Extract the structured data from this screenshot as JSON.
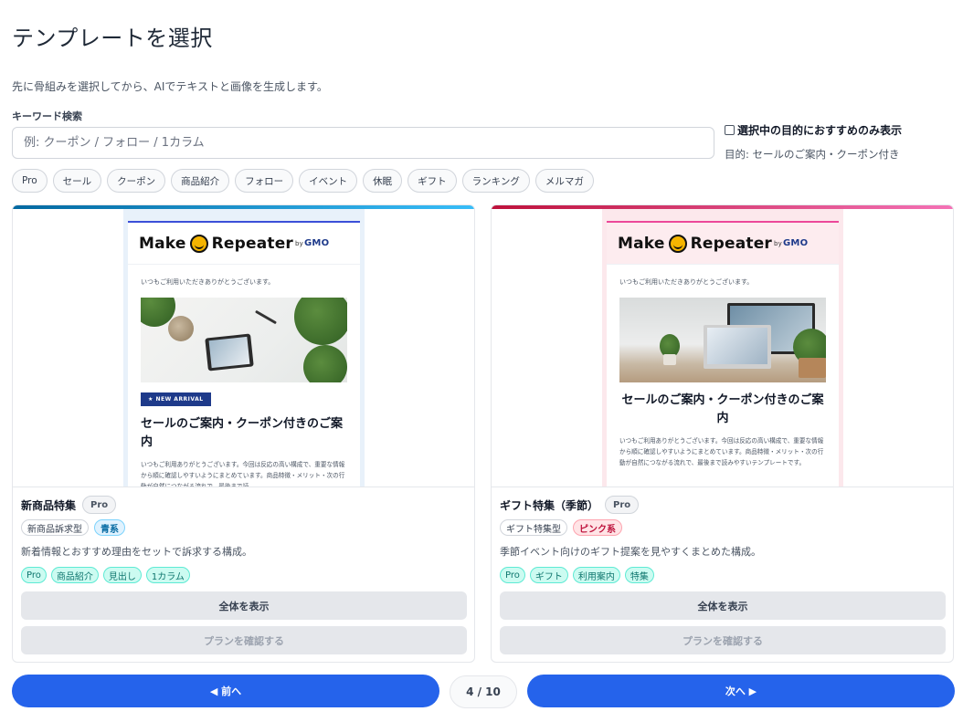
{
  "header": {
    "title": "テンプレートを選択",
    "description": "先に骨組みを選択してから、AIでテキストと画像を生成します。"
  },
  "search": {
    "label": "キーワード検索",
    "placeholder": "例: クーポン / フォロー / 1カラム",
    "value": ""
  },
  "recommend": {
    "label": "選択中の目的におすすめのみ表示",
    "checked": false,
    "purpose": "目的: セールのご案内・クーポン付き"
  },
  "filter_chips": [
    "Pro",
    "セール",
    "クーポン",
    "商品紹介",
    "フォロー",
    "イベント",
    "休眠",
    "ギフト",
    "ランキング",
    "メルマガ"
  ],
  "cards": [
    {
      "preview": {
        "logo_make": "Make",
        "logo_repeater": "Repeater",
        "logo_by": "by",
        "logo_gmo": "GMO",
        "greeting": "いつもご利用いただきありがとうございます。",
        "badge": "★ NEW ARRIVAL",
        "headline": "セールのご案内・クーポン付きのご案内",
        "body": "いつもご利用ありがとうございます。今回は反応の高い構成で、重要な情報から順に確認しやすいようにまとめています。商品特徴・メリット・次の行動が自然につながる流れで、最後まで読"
      },
      "name": "新商品特集",
      "pro": "Pro",
      "type_tag": "新商品訴求型",
      "color_tag": "青系",
      "description": "新着情報とおすすめ理由をセットで訴求する構成。",
      "tags": [
        "Pro",
        "商品紹介",
        "見出し",
        "1カラム"
      ],
      "view_label": "全体を表示",
      "plan_label": "プランを確認する"
    },
    {
      "preview": {
        "logo_make": "Make",
        "logo_repeater": "Repeater",
        "logo_by": "by",
        "logo_gmo": "GMO",
        "greeting": "いつもご利用いただきありがとうございます。",
        "headline": "セールのご案内・クーポン付きのご案内",
        "body": "いつもご利用ありがとうございます。今回は反応の高い構成で、重要な情報から順に確認しやすいようにまとめています。商品特徴・メリット・次の行動が自然につながる流れで、最後まで読みやすいテンプレートです。"
      },
      "name": "ギフト特集（季節）",
      "pro": "Pro",
      "type_tag": "ギフト特集型",
      "color_tag": "ピンク系",
      "description": "季節イベント向けのギフト提案を見やすくまとめた構成。",
      "tags": [
        "Pro",
        "ギフト",
        "利用案内",
        "特集"
      ],
      "view_label": "全体を表示",
      "plan_label": "プランを確認する"
    }
  ],
  "pagination": {
    "prev_label": "◀ 前へ",
    "next_label": "次へ ▶",
    "indicator": "4 / 10"
  }
}
